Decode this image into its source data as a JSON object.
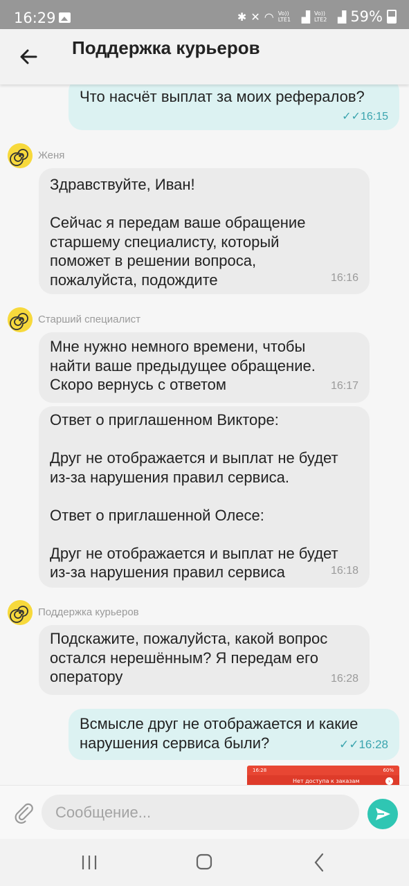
{
  "status_bar": {
    "time": "16:29",
    "sim1_label": "Vo)) LTE1",
    "sim2_label": "Vo)) LTE2",
    "battery": "59%"
  },
  "header": {
    "title": "Поддержка курьеров"
  },
  "messages": [
    {
      "type": "outgoing",
      "text": "Что насчёт выплат за моих рефералов?",
      "time": "16:15",
      "status": "read"
    },
    {
      "type": "sender",
      "name": "Женя"
    },
    {
      "type": "incoming",
      "text": "Здравствуйте, Иван!\n\nСейчас я передам ваше обращение\nстаршему специалисту, который\nпоможет в решении вопроса,\nпожалуйста, подождите",
      "time": "16:16"
    },
    {
      "type": "sender",
      "name": "Старший специалист"
    },
    {
      "type": "incoming",
      "text": "Мне нужно немного времени, чтобы\nнайти ваше предыдущее обращение.\nСкоро вернусь с ответом",
      "time": "16:17"
    },
    {
      "type": "incoming",
      "text": "Ответ о приглашенном Викторе:\n\nДруг не отображается и выплат не будет\nиз-за нарушения правил сервиса.\n\nОтвет о приглашенной Олесе:\n\nДруг не отображается и выплат не будет\nиз-за нарушения правил сервиса",
      "time": "16:18"
    },
    {
      "type": "sender",
      "name": "Поддержка курьеров"
    },
    {
      "type": "incoming",
      "text": "Подскажите, пожалуйста, какой вопрос\nостался нерешённым? Я передам его\nоператору",
      "time": "16:28"
    },
    {
      "type": "outgoing",
      "text": "Всмысле друг не отображается и какие\nнарушения сервиса были?",
      "time": "16:28",
      "status": "read"
    }
  ],
  "image_preview": {
    "time": "16:28",
    "battery": "60%",
    "banner_text": "Нет доступа к заказам"
  },
  "composer": {
    "placeholder": "Сообщение..."
  },
  "colors": {
    "outgoing_bubble": "#dcf2f2",
    "incoming_bubble": "#ebebeb",
    "accent": "#2fc6b3",
    "avatar": "#f7d93c"
  },
  "icons": [
    "back-arrow-icon",
    "attach-icon",
    "send-icon",
    "recents-icon",
    "home-icon",
    "back-icon",
    "spiral-avatar-icon",
    "double-check-icon"
  ]
}
